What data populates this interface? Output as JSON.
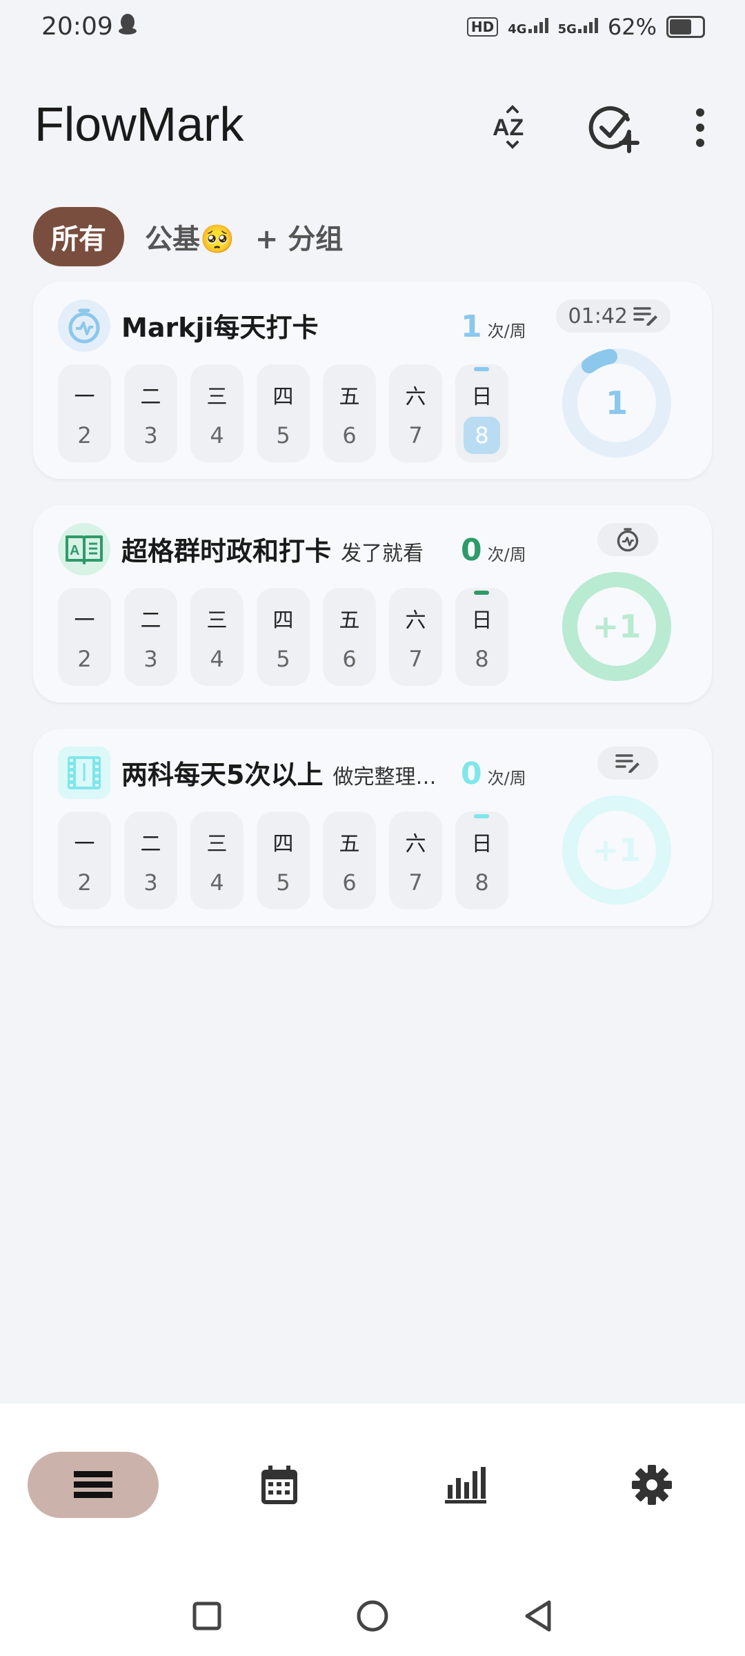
{
  "status_bar": {
    "time": "20:09",
    "hd": "HD",
    "net1": "4G",
    "net2": "5G",
    "battery": "62%",
    "battery_level": 0.62
  },
  "header": {
    "title": "FlowMark"
  },
  "tabs": {
    "all": "所有",
    "group1": "公基🥺",
    "add_group": "+ 分组"
  },
  "cards": [
    {
      "title": "Markji每天打卡",
      "subtitle": "",
      "count": "1",
      "unit": "次/周",
      "pill_time": "01:42",
      "accent": "#8cc7ec",
      "ring_color": "#e3eef9",
      "ring_text": "1",
      "ring_progress": 0.14,
      "weekdays": [
        "一",
        "二",
        "三",
        "四",
        "五",
        "六",
        "日"
      ],
      "dates": [
        "2",
        "3",
        "4",
        "5",
        "6",
        "7",
        "8"
      ]
    },
    {
      "title": "超格群时政和打卡",
      "subtitle": "发了就看",
      "count": "0",
      "unit": "次/周",
      "pill_time": "",
      "accent": "#2e9a6a",
      "ring_color": "#b9ead2",
      "ring_text": "+1",
      "weekdays": [
        "一",
        "二",
        "三",
        "四",
        "五",
        "六",
        "日"
      ],
      "dates": [
        "2",
        "3",
        "4",
        "5",
        "6",
        "7",
        "8"
      ]
    },
    {
      "title": "两科每天5次以上",
      "subtitle": "做完整理…",
      "count": "0",
      "unit": "次/周",
      "pill_time": "",
      "accent": "#7fe6ea",
      "ring_color": "#dcf8f9",
      "ring_text": "+1",
      "weekdays": [
        "一",
        "二",
        "三",
        "四",
        "五",
        "六",
        "日"
      ],
      "dates": [
        "2",
        "3",
        "4",
        "5",
        "6",
        "7",
        "8"
      ]
    }
  ]
}
